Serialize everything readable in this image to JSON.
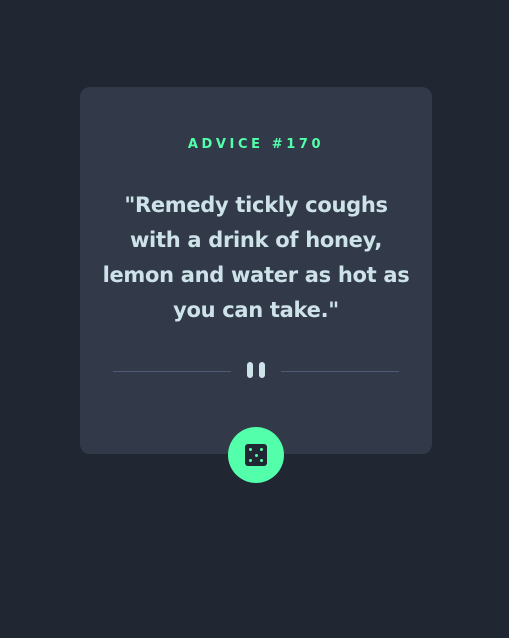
{
  "advice": {
    "id_label": "ADVICE #170",
    "quote": "\"Remedy tickly coughs with a drink of honey, lemon and water as hot as you can take.\""
  },
  "icons": {
    "divider": "pause-icon",
    "button": "dice-icon"
  },
  "colors": {
    "background": "#202632",
    "card": "#323a49",
    "accent": "#53ffaa",
    "text": "#cee3e9",
    "divider_line": "#4f5d74"
  }
}
